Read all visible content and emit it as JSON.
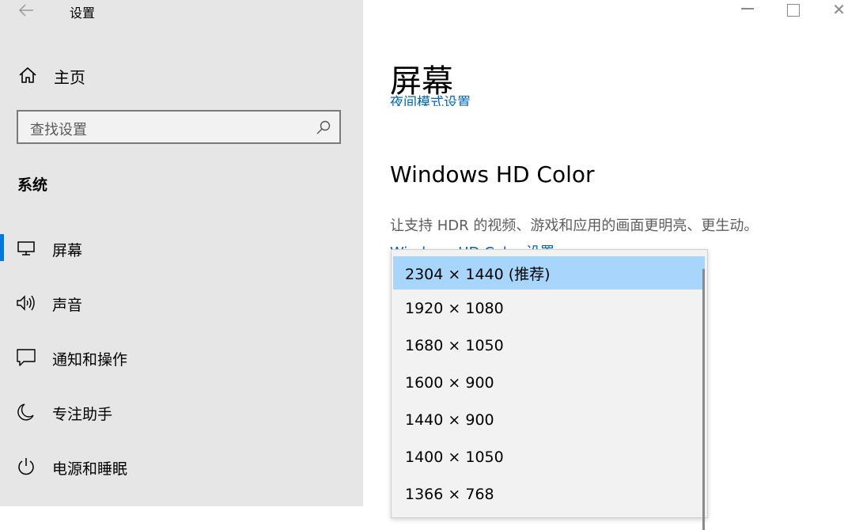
{
  "window": {
    "title": "设置"
  },
  "sidebar": {
    "home_label": "主页",
    "search_placeholder": "查找设置",
    "group_title": "系统",
    "items": [
      {
        "label": "屏幕",
        "icon": "monitor-icon",
        "selected": true
      },
      {
        "label": "声音",
        "icon": "speaker-icon"
      },
      {
        "label": "通知和操作",
        "icon": "notification-icon"
      },
      {
        "label": "专注助手",
        "icon": "moon-icon"
      },
      {
        "label": "电源和睡眠",
        "icon": "power-icon"
      }
    ]
  },
  "main": {
    "page_title": "屏幕",
    "night_light_link": "夜间模式设置",
    "hd_color_title": "Windows HD Color",
    "hd_color_desc": "让支持 HDR 的视频、游戏和应用的画面更明亮、更生动。",
    "hd_color_link": "Windows HD Color 设置"
  },
  "resolution_dropdown": {
    "selected_index": 0,
    "options": [
      "2304 × 1440 (推荐)",
      "1920 × 1080",
      "1680 × 1050",
      "1600 × 900",
      "1440 × 900",
      "1400 × 1050",
      "1366 × 768"
    ]
  },
  "colors": {
    "accent": "#0078d7",
    "link": "#0067b8",
    "selected_option": "#a8d5fb"
  }
}
